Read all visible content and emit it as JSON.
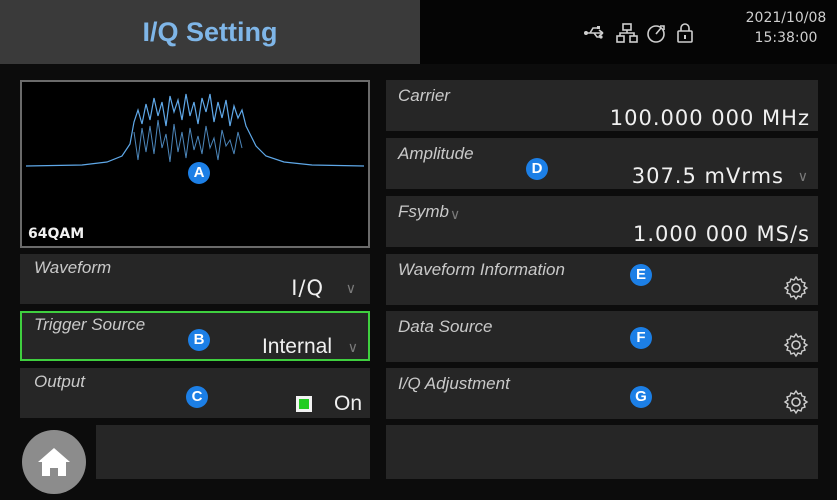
{
  "header": {
    "title": "I/Q Setting"
  },
  "status": {
    "date": "2021/10/08",
    "time": "15:38:00",
    "icons": [
      "usb-icon",
      "network-icon",
      "clock-icon",
      "lock-icon"
    ]
  },
  "preview": {
    "modulation": "64QAM",
    "marker": "A"
  },
  "left_panels": {
    "waveform": {
      "label": "Waveform",
      "value": "I/Q"
    },
    "trigger_source": {
      "label": "Trigger Source",
      "value": "Internal",
      "marker": "B"
    },
    "output": {
      "label": "Output",
      "value": "On",
      "marker": "C"
    }
  },
  "right_panels": {
    "carrier": {
      "label": "Carrier",
      "value": "100.000 000 MHz"
    },
    "amplitude": {
      "label": "Amplitude",
      "value": "307.5 mVrms",
      "marker": "D"
    },
    "fsymb": {
      "label": "Fsymb",
      "value": "1.000 000 MS/s"
    },
    "waveform_information": {
      "label": "Waveform Information",
      "marker": "E"
    },
    "data_source": {
      "label": "Data Source",
      "marker": "F"
    },
    "iq_adjustment": {
      "label": "I/Q Adjustment",
      "marker": "G"
    }
  },
  "colors": {
    "accent_title": "#7fb6e8",
    "marker": "#1c7fe6",
    "focus_border": "#3fcf3f",
    "on_indicator": "#22cc22"
  }
}
